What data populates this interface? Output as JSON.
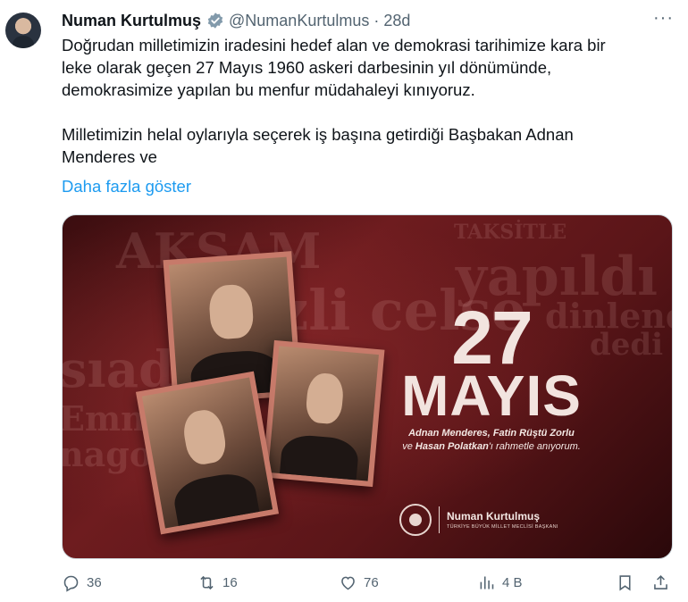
{
  "author": {
    "name": "Numan Kurtulmuş",
    "handle": "@NumanKurtulmus",
    "separator": "·",
    "time": "28d"
  },
  "tweet": {
    "paragraphs": [
      "Doğrudan milletimizin iradesini hedef alan ve demokrasi tarihimize kara bir\nleke olarak geçen 27 Mayıs 1960 askeri darbesinin yıl dönümünde,\ndemokrasimize yapılan bu menfur müdahaleyi kınıyoruz.",
      "Milletimizin helal oylarıyla seçerek iş başına getirdiği Başbakan Adnan\nMenderes ve"
    ],
    "show_more": "Daha fazla göster",
    "more_menu": "···"
  },
  "media": {
    "background_words": [
      "AKŞAM",
      "TAKSİTLE",
      "yapıldı",
      "zli celse",
      "dinlendi",
      "dedi",
      "sıad",
      "Emni",
      "nago"
    ],
    "number": "27",
    "month": "MAYIS",
    "caption_names_1": "Adnan Menderes, Fatin Rüştü Zorlu",
    "caption_ve": "ve",
    "caption_names_2": "Hasan Polatkan",
    "caption_rest": "'ı rahmetle anıyorum.",
    "logo_name": "Numan Kurtulmuş",
    "logo_sub": "TÜRKİYE BÜYÜK MİLLET MECLİSİ BAŞKANI"
  },
  "actions": {
    "replies": "36",
    "reposts": "16",
    "likes": "76",
    "views": "4 B"
  },
  "icons": [
    "verified-badge-icon",
    "more-icon",
    "reply-icon",
    "repost-icon",
    "like-icon",
    "views-icon",
    "bookmark-icon",
    "share-icon"
  ]
}
